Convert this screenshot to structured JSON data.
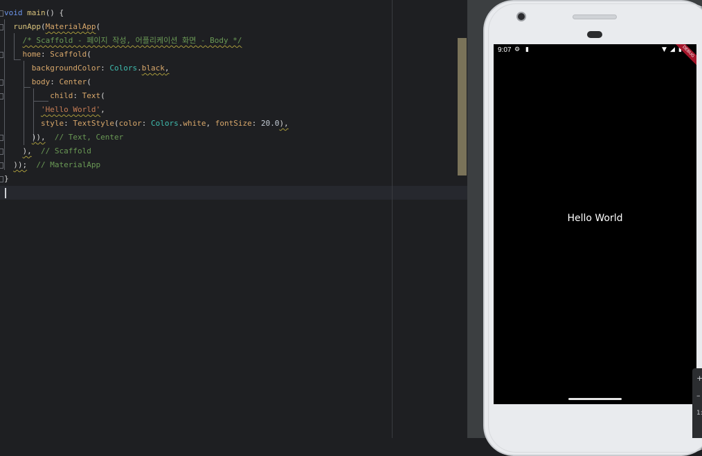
{
  "editor": {
    "lines": [
      [
        {
          "t": "void",
          "c": "kw"
        },
        {
          "t": " ",
          "c": "plain"
        },
        {
          "t": "main",
          "c": "fn"
        },
        {
          "t": "() {",
          "c": "plain"
        }
      ],
      [
        {
          "t": "  ",
          "c": "plain"
        },
        {
          "t": "runApp",
          "c": "fn"
        },
        {
          "t": "(",
          "c": "plain"
        },
        {
          "t": "MaterialApp",
          "c": "cls",
          "sq": true
        },
        {
          "t": "(",
          "c": "plain"
        }
      ],
      [
        {
          "t": "    ",
          "c": "plain"
        },
        {
          "t": "/* Scaffold - 페이지 작성, 어플리케이션 화면 - Body */",
          "c": "cmt",
          "sq": true
        }
      ],
      [
        {
          "t": "    ",
          "c": "plain"
        },
        {
          "t": "home",
          "c": "prop"
        },
        {
          "t": ": ",
          "c": "plain"
        },
        {
          "t": "Scaffold",
          "c": "cls"
        },
        {
          "t": "(",
          "c": "plain"
        }
      ],
      [
        {
          "t": "      ",
          "c": "plain"
        },
        {
          "t": "backgroundColor",
          "c": "prop"
        },
        {
          "t": ": ",
          "c": "plain"
        },
        {
          "t": "Colors",
          "c": "member"
        },
        {
          "t": ".",
          "c": "plain"
        },
        {
          "t": "black",
          "c": "prop",
          "sq": true
        },
        {
          "t": ",",
          "c": "plain",
          "sq": true
        }
      ],
      [
        {
          "t": "      ",
          "c": "plain"
        },
        {
          "t": "body",
          "c": "prop"
        },
        {
          "t": ": ",
          "c": "plain"
        },
        {
          "t": "Center",
          "c": "cls"
        },
        {
          "t": "(",
          "c": "plain"
        }
      ],
      [
        {
          "t": "          ",
          "c": "plain"
        },
        {
          "t": "child",
          "c": "prop"
        },
        {
          "t": ": ",
          "c": "plain"
        },
        {
          "t": "Text",
          "c": "cls"
        },
        {
          "t": "(",
          "c": "plain"
        }
      ],
      [
        {
          "t": "        ",
          "c": "plain"
        },
        {
          "t": "'Hello World'",
          "c": "str",
          "sq": true
        },
        {
          "t": ",",
          "c": "plain"
        }
      ],
      [
        {
          "t": "        ",
          "c": "plain"
        },
        {
          "t": "style",
          "c": "prop"
        },
        {
          "t": ": ",
          "c": "plain"
        },
        {
          "t": "TextStyle",
          "c": "cls"
        },
        {
          "t": "(",
          "c": "plain"
        },
        {
          "t": "color",
          "c": "prop"
        },
        {
          "t": ": ",
          "c": "plain"
        },
        {
          "t": "Colors",
          "c": "member"
        },
        {
          "t": ".",
          "c": "plain"
        },
        {
          "t": "white",
          "c": "prop"
        },
        {
          "t": ", ",
          "c": "plain"
        },
        {
          "t": "fontSize",
          "c": "prop"
        },
        {
          "t": ": ",
          "c": "plain"
        },
        {
          "t": "20.0",
          "c": "num"
        },
        {
          "t": "),",
          "c": "plain",
          "sq": true
        }
      ],
      [
        {
          "t": "      ",
          "c": "plain"
        },
        {
          "t": ")),",
          "c": "plain",
          "sq": true
        },
        {
          "t": "  ",
          "c": "plain"
        },
        {
          "t": "// Text, Center",
          "c": "cmt2"
        }
      ],
      [
        {
          "t": "    ",
          "c": "plain"
        },
        {
          "t": "),",
          "c": "plain",
          "sq": true
        },
        {
          "t": "  ",
          "c": "plain"
        },
        {
          "t": "// Scaffold",
          "c": "cmt2"
        }
      ],
      [
        {
          "t": "  ",
          "c": "plain"
        },
        {
          "t": "));",
          "c": "plain",
          "sq": true
        },
        {
          "t": "  ",
          "c": "plain"
        },
        {
          "t": "// MaterialApp",
          "c": "cmt2"
        }
      ],
      [
        {
          "t": "}",
          "c": "plain"
        }
      ],
      [
        {
          "t": "",
          "c": "plain"
        }
      ]
    ]
  },
  "device": {
    "status_time": "9:07",
    "status_left_icons": [
      "settings-icon",
      "sd-card-icon"
    ],
    "status_right_icons": [
      "wifi-icon",
      "signal-icon",
      "battery-icon"
    ],
    "debug_banner": "DEBUG",
    "app_text": "Hello World"
  },
  "side_toolbar": {
    "glyphs": [
      "+",
      "–",
      "1:"
    ]
  }
}
